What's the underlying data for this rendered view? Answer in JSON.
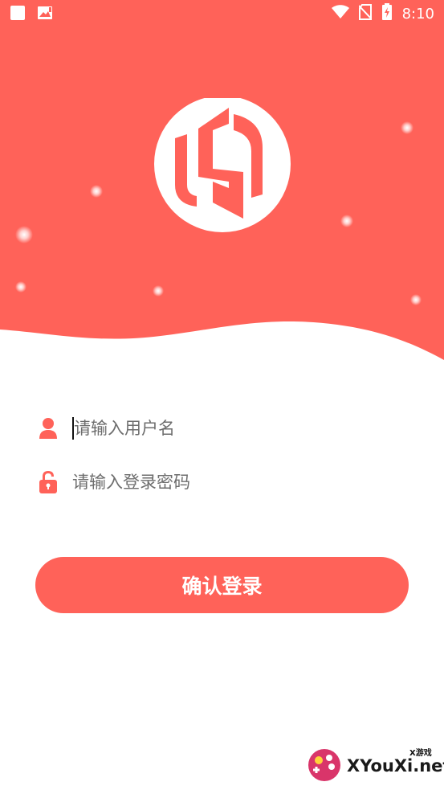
{
  "status_bar": {
    "time": "8:10",
    "left_icons": [
      "square-icon",
      "image-notification-icon"
    ],
    "right_icons": [
      "wifi-icon",
      "no-sim-icon",
      "battery-charging-icon"
    ]
  },
  "brand": {
    "logo_icon": "brand-logo-icon",
    "primary_color": "#ff6259"
  },
  "form": {
    "username": {
      "icon": "user-icon",
      "placeholder": "请输入用户名",
      "value": ""
    },
    "password": {
      "icon": "lock-icon",
      "placeholder": "请输入登录密码",
      "value": ""
    },
    "submit_label": "确认登录"
  },
  "watermark": {
    "text": "XYouXi.net",
    "small_text": "X游戏",
    "icon": "gamepad-icon"
  }
}
